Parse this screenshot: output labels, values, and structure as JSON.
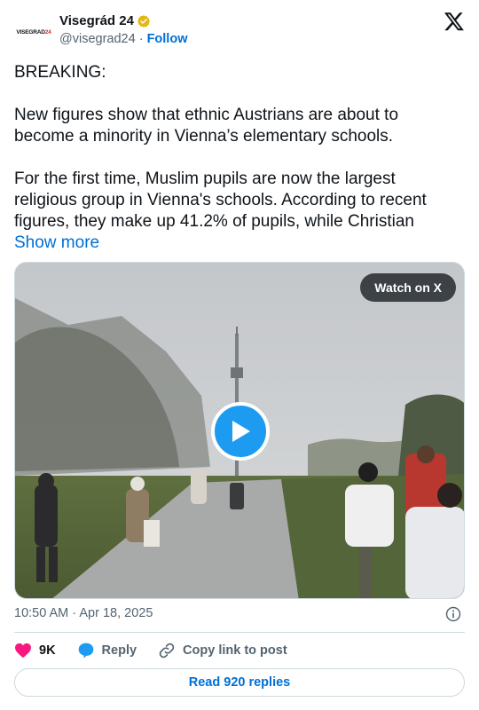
{
  "author": {
    "display_name": "Visegrád 24",
    "handle": "@visegrad24",
    "separator": "·",
    "follow_label": "Follow",
    "avatar_text_main": "VISEGRAD",
    "avatar_text_accent": "24"
  },
  "tweet": {
    "text": "BREAKING:\n\nNew figures show that ethnic Austrians are about to become a minority in Vienna’s elementary schools.\n\nFor the first time, Muslim pupils are now the largest religious group in Vienna's schools. According to recent figures, they make up 41.2% of pupils, while Christian ",
    "show_more_label": "Show more"
  },
  "media": {
    "watch_label": "Watch on X"
  },
  "meta": {
    "timestamp": "10:50 AM · Apr 18, 2025"
  },
  "actions": {
    "like_count": "9K",
    "reply_label": "Reply",
    "copy_label": "Copy link to post"
  },
  "footer": {
    "read_replies_label": "Read 920 replies"
  },
  "colors": {
    "link": "#006fd6",
    "like": "#f91880",
    "reply": "#1d9bf0",
    "muted": "#536471"
  }
}
